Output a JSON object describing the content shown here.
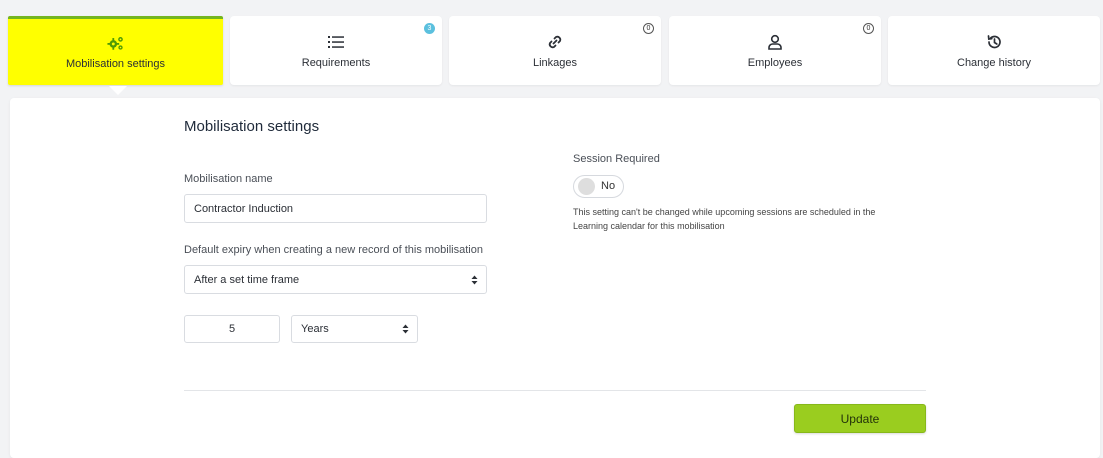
{
  "tabs": [
    {
      "label": "Mobilisation settings",
      "icon": "gears-icon",
      "active": true
    },
    {
      "label": "Requirements",
      "icon": "list-icon",
      "badge": "3"
    },
    {
      "label": "Linkages",
      "icon": "link-icon",
      "badge": "0"
    },
    {
      "label": "Employees",
      "icon": "user-icon",
      "badge": "0"
    },
    {
      "label": "Change history",
      "icon": "history-icon"
    }
  ],
  "form": {
    "title": "Mobilisation settings",
    "name_label": "Mobilisation name",
    "name_value": "Contractor Induction",
    "expiry_label": "Default expiry when creating a new record of this mobilisation",
    "expiry_value": "After a set time frame",
    "duration_value": "5",
    "duration_unit": "Years",
    "session_label": "Session Required",
    "session_toggle": "No",
    "session_note": "This setting can't be changed while upcoming sessions are scheduled in the Learning calendar for this mobilisation",
    "update_button": "Update"
  },
  "colors": {
    "active_tab_bg": "#ffff00",
    "active_tab_border": "#74b51f",
    "accent_green": "#9acd1f",
    "badge_blue": "#5bc0de"
  }
}
